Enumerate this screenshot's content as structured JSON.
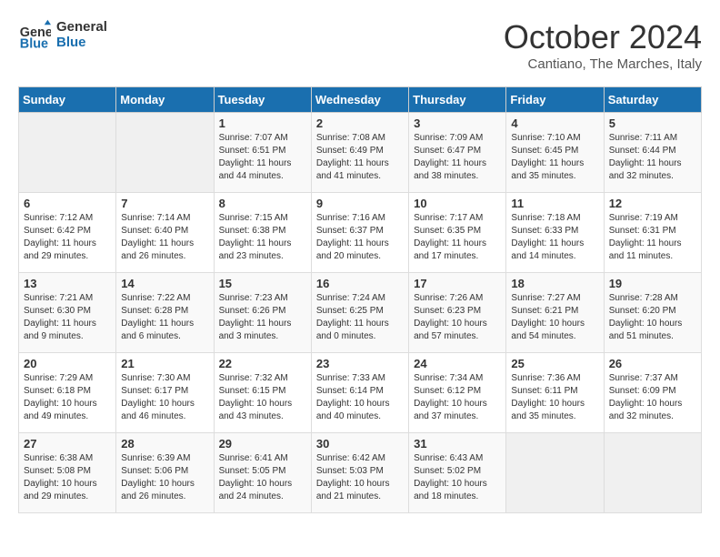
{
  "logo": {
    "line1": "General",
    "line2": "Blue"
  },
  "title": "October 2024",
  "location": "Cantiano, The Marches, Italy",
  "days_of_week": [
    "Sunday",
    "Monday",
    "Tuesday",
    "Wednesday",
    "Thursday",
    "Friday",
    "Saturday"
  ],
  "weeks": [
    [
      {
        "day": "",
        "info": ""
      },
      {
        "day": "",
        "info": ""
      },
      {
        "day": "1",
        "info": "Sunrise: 7:07 AM\nSunset: 6:51 PM\nDaylight: 11 hours and 44 minutes."
      },
      {
        "day": "2",
        "info": "Sunrise: 7:08 AM\nSunset: 6:49 PM\nDaylight: 11 hours and 41 minutes."
      },
      {
        "day": "3",
        "info": "Sunrise: 7:09 AM\nSunset: 6:47 PM\nDaylight: 11 hours and 38 minutes."
      },
      {
        "day": "4",
        "info": "Sunrise: 7:10 AM\nSunset: 6:45 PM\nDaylight: 11 hours and 35 minutes."
      },
      {
        "day": "5",
        "info": "Sunrise: 7:11 AM\nSunset: 6:44 PM\nDaylight: 11 hours and 32 minutes."
      }
    ],
    [
      {
        "day": "6",
        "info": "Sunrise: 7:12 AM\nSunset: 6:42 PM\nDaylight: 11 hours and 29 minutes."
      },
      {
        "day": "7",
        "info": "Sunrise: 7:14 AM\nSunset: 6:40 PM\nDaylight: 11 hours and 26 minutes."
      },
      {
        "day": "8",
        "info": "Sunrise: 7:15 AM\nSunset: 6:38 PM\nDaylight: 11 hours and 23 minutes."
      },
      {
        "day": "9",
        "info": "Sunrise: 7:16 AM\nSunset: 6:37 PM\nDaylight: 11 hours and 20 minutes."
      },
      {
        "day": "10",
        "info": "Sunrise: 7:17 AM\nSunset: 6:35 PM\nDaylight: 11 hours and 17 minutes."
      },
      {
        "day": "11",
        "info": "Sunrise: 7:18 AM\nSunset: 6:33 PM\nDaylight: 11 hours and 14 minutes."
      },
      {
        "day": "12",
        "info": "Sunrise: 7:19 AM\nSunset: 6:31 PM\nDaylight: 11 hours and 11 minutes."
      }
    ],
    [
      {
        "day": "13",
        "info": "Sunrise: 7:21 AM\nSunset: 6:30 PM\nDaylight: 11 hours and 9 minutes."
      },
      {
        "day": "14",
        "info": "Sunrise: 7:22 AM\nSunset: 6:28 PM\nDaylight: 11 hours and 6 minutes."
      },
      {
        "day": "15",
        "info": "Sunrise: 7:23 AM\nSunset: 6:26 PM\nDaylight: 11 hours and 3 minutes."
      },
      {
        "day": "16",
        "info": "Sunrise: 7:24 AM\nSunset: 6:25 PM\nDaylight: 11 hours and 0 minutes."
      },
      {
        "day": "17",
        "info": "Sunrise: 7:26 AM\nSunset: 6:23 PM\nDaylight: 10 hours and 57 minutes."
      },
      {
        "day": "18",
        "info": "Sunrise: 7:27 AM\nSunset: 6:21 PM\nDaylight: 10 hours and 54 minutes."
      },
      {
        "day": "19",
        "info": "Sunrise: 7:28 AM\nSunset: 6:20 PM\nDaylight: 10 hours and 51 minutes."
      }
    ],
    [
      {
        "day": "20",
        "info": "Sunrise: 7:29 AM\nSunset: 6:18 PM\nDaylight: 10 hours and 49 minutes."
      },
      {
        "day": "21",
        "info": "Sunrise: 7:30 AM\nSunset: 6:17 PM\nDaylight: 10 hours and 46 minutes."
      },
      {
        "day": "22",
        "info": "Sunrise: 7:32 AM\nSunset: 6:15 PM\nDaylight: 10 hours and 43 minutes."
      },
      {
        "day": "23",
        "info": "Sunrise: 7:33 AM\nSunset: 6:14 PM\nDaylight: 10 hours and 40 minutes."
      },
      {
        "day": "24",
        "info": "Sunrise: 7:34 AM\nSunset: 6:12 PM\nDaylight: 10 hours and 37 minutes."
      },
      {
        "day": "25",
        "info": "Sunrise: 7:36 AM\nSunset: 6:11 PM\nDaylight: 10 hours and 35 minutes."
      },
      {
        "day": "26",
        "info": "Sunrise: 7:37 AM\nSunset: 6:09 PM\nDaylight: 10 hours and 32 minutes."
      }
    ],
    [
      {
        "day": "27",
        "info": "Sunrise: 6:38 AM\nSunset: 5:08 PM\nDaylight: 10 hours and 29 minutes."
      },
      {
        "day": "28",
        "info": "Sunrise: 6:39 AM\nSunset: 5:06 PM\nDaylight: 10 hours and 26 minutes."
      },
      {
        "day": "29",
        "info": "Sunrise: 6:41 AM\nSunset: 5:05 PM\nDaylight: 10 hours and 24 minutes."
      },
      {
        "day": "30",
        "info": "Sunrise: 6:42 AM\nSunset: 5:03 PM\nDaylight: 10 hours and 21 minutes."
      },
      {
        "day": "31",
        "info": "Sunrise: 6:43 AM\nSunset: 5:02 PM\nDaylight: 10 hours and 18 minutes."
      },
      {
        "day": "",
        "info": ""
      },
      {
        "day": "",
        "info": ""
      }
    ]
  ]
}
